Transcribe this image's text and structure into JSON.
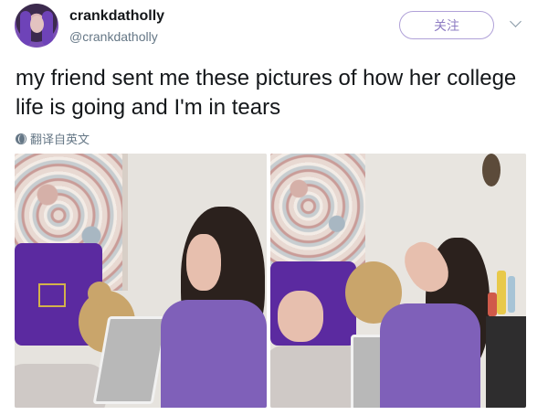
{
  "tweet": {
    "display_name": "crankdatholly",
    "handle": "@crankdatholly",
    "follow_label": "关注",
    "text": "my friend sent me these pictures of how her college life is going and I'm in tears",
    "translate_label": "翻译自英文"
  },
  "icons": {
    "menu": "chevron-down-icon",
    "translate": "globe-icon"
  },
  "colors": {
    "follow_accent": "#8e7cc3",
    "secondary_text": "#657786",
    "primary_text": "#14171a"
  }
}
